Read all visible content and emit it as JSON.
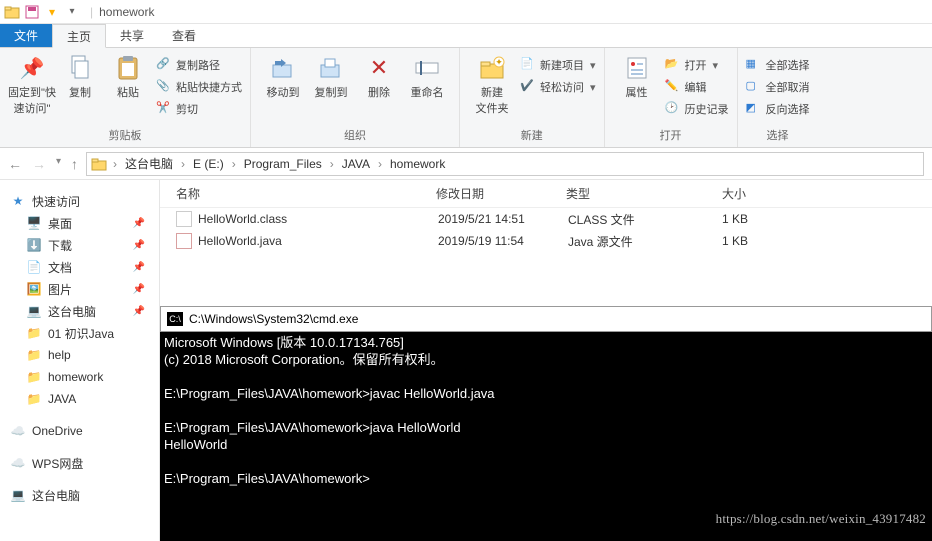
{
  "title": {
    "folder": "homework"
  },
  "tabs": {
    "file": "文件",
    "home": "主页",
    "share": "共享",
    "view": "查看"
  },
  "ribbon": {
    "pin": {
      "label": "固定到\"快\n速访问\""
    },
    "copy": "复制",
    "paste": "粘贴",
    "clipboard": {
      "copy_path": "复制路径",
      "paste_shortcut": "粘贴快捷方式",
      "cut": "剪切",
      "group": "剪贴板"
    },
    "organize": {
      "move": "移动到",
      "copy": "复制到",
      "delete": "删除",
      "rename": "重命名",
      "group": "组织"
    },
    "new": {
      "folder": "新建\n文件夹",
      "item": "新建项目",
      "easy": "轻松访问",
      "group": "新建"
    },
    "open": {
      "props": "属性",
      "open": "打开",
      "edit": "编辑",
      "history": "历史记录",
      "group": "打开"
    },
    "select": {
      "all": "全部选择",
      "none": "全部取消",
      "invert": "反向选择",
      "group": "选择"
    }
  },
  "crumbs": [
    "这台电脑",
    "E (E:)",
    "Program_Files",
    "JAVA",
    "homework"
  ],
  "columns": {
    "name": "名称",
    "date": "修改日期",
    "type": "类型",
    "size": "大小"
  },
  "files": [
    {
      "name": "HelloWorld.class",
      "date": "2019/5/21 14:51",
      "type": "CLASS 文件",
      "size": "1 KB",
      "kind": "class"
    },
    {
      "name": "HelloWorld.java",
      "date": "2019/5/19 11:54",
      "type": "Java 源文件",
      "size": "1 KB",
      "kind": "java"
    }
  ],
  "sidebar": {
    "quick": "快速访问",
    "desktop": "桌面",
    "downloads": "下载",
    "documents": "文档",
    "pictures": "图片",
    "thispc": "这台电脑",
    "f_java01": "01 初识Java",
    "f_help": "help",
    "f_homework": "homework",
    "f_JAVA": "JAVA",
    "onedrive": "OneDrive",
    "wps": "WPS网盘",
    "thispc2": "这台电脑"
  },
  "cmd": {
    "title": "C:\\Windows\\System32\\cmd.exe",
    "body": "Microsoft Windows [版本 10.0.17134.765]\n(c) 2018 Microsoft Corporation。保留所有权利。\n\nE:\\Program_Files\\JAVA\\homework>javac HelloWorld.java\n\nE:\\Program_Files\\JAVA\\homework>java HelloWorld\nHelloWorld\n\nE:\\Program_Files\\JAVA\\homework>"
  },
  "watermark": "https://blog.csdn.net/weixin_43917482"
}
